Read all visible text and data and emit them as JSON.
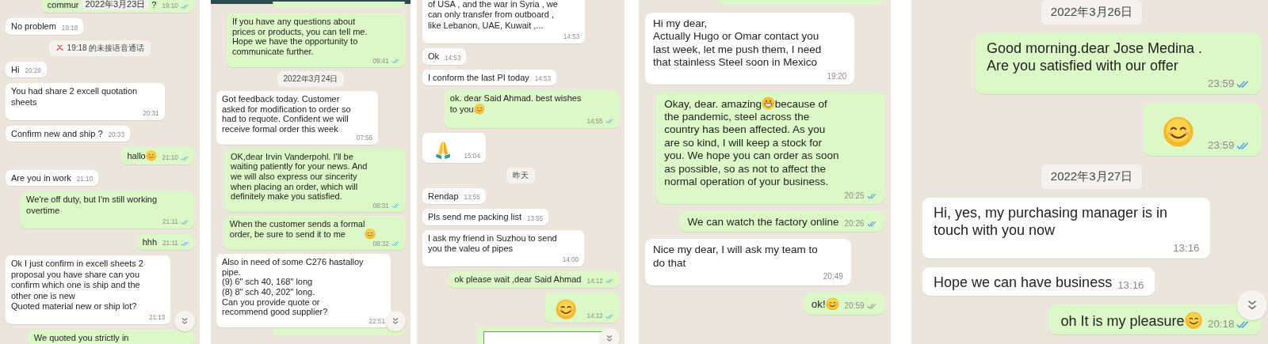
{
  "panels": [
    {
      "app_bar": false,
      "scroll_button": true,
      "messages": [
        {
          "kind": "out",
          "parts": [
            {
              "kind": "text",
              "text": "commur"
            },
            {
              "kind": "date",
              "text": "2022年3月23日"
            },
            {
              "kind": "text",
              "text": "?"
            }
          ],
          "time": "19:10",
          "read": true
        },
        {
          "kind": "in",
          "parts": [
            {
              "kind": "text",
              "text": "No problem"
            }
          ],
          "time": "19:18"
        },
        {
          "kind": "missed_call",
          "text": "19:18 的未接语音通话"
        },
        {
          "kind": "in",
          "parts": [
            {
              "kind": "text",
              "text": "Hi"
            }
          ],
          "time": "20:29"
        },
        {
          "kind": "in",
          "parts": [
            {
              "kind": "text",
              "text": "You had share 2 excell quotation\nsheets"
            }
          ],
          "time": "20:31"
        },
        {
          "kind": "in",
          "parts": [
            {
              "kind": "text",
              "text": "Confirm new and ship ?"
            }
          ],
          "time": "20:33"
        },
        {
          "kind": "out",
          "parts": [
            {
              "kind": "text",
              "text": "hallo"
            },
            {
              "kind": "smile"
            }
          ],
          "time": "21:10",
          "read": true
        },
        {
          "kind": "in",
          "parts": [
            {
              "kind": "text",
              "text": "Are you in work"
            }
          ],
          "time": "21:10"
        },
        {
          "kind": "out",
          "parts": [
            {
              "kind": "text",
              "text": "We're off duty, but I'm still working\novertime"
            }
          ],
          "time": "21:11",
          "read": true
        },
        {
          "kind": "out",
          "parts": [
            {
              "kind": "text",
              "text": "hhh"
            }
          ],
          "time": "21:11",
          "read": true
        },
        {
          "kind": "in",
          "parts": [
            {
              "kind": "text",
              "text": "Ok I just confirm in excell sheets 2\nproposal you have share can you\nconfirm which one is ship and the\nother one is new\nQuoted material new or ship lot?"
            }
          ],
          "time": "21:13"
        },
        {
          "kind": "out",
          "parts": [
            {
              "kind": "text",
              "text": "We quoted you strictly in"
            }
          ]
        }
      ]
    },
    {
      "app_bar": true,
      "scroll_button": true,
      "messages": [
        {
          "kind": "out_fragment"
        },
        {
          "kind": "out",
          "parts": [
            {
              "kind": "text",
              "text": "If you have any questions about\nprices or products, you can tell me.\nHope we have the opportunity to\ncommunicate further."
            }
          ],
          "time": "09:41",
          "read": true
        },
        {
          "kind": "date",
          "text": "2022年3月24日"
        },
        {
          "kind": "in",
          "parts": [
            {
              "kind": "text",
              "text": "Got feedback today.  Customer\nasked for modification to order so\nhad to requote.  Confident we will\nreceive formal order this week"
            }
          ],
          "time": "07:56"
        },
        {
          "kind": "out",
          "parts": [
            {
              "kind": "text",
              "text": "OK,dear Irvin Vanderpohl. I'll be\nwaiting patiently for your news. And\nwe will also express our sincerity\nwhen placing an order, which will\ndefinitely make you satisfied."
            }
          ],
          "time": "08:31",
          "read": true
        },
        {
          "kind": "out",
          "parts": [
            {
              "kind": "text",
              "text": "When the customer sends a formal\norder, be sure to send it to me"
            },
            {
              "kind": "smile"
            }
          ],
          "time": "08:32",
          "read": true
        },
        {
          "kind": "in",
          "parts": [
            {
              "kind": "text",
              "text": "Also in need of some C276 hastalloy\npipe.\n(9) 6\" sch 40, 168\" long\n(8) 8\" sch 40, 202\" long.\nCan you provide quote or\nrecommend good supplier?"
            }
          ],
          "time": "22:51"
        },
        {
          "kind": "out_fragment"
        }
      ]
    },
    {
      "app_bar": false,
      "scroll_button": true,
      "messages": [
        {
          "kind": "in",
          "parts": [
            {
              "kind": "text",
              "text": "of USA  , and the war in Syria , we\ncan only transfer from outboard ,\nlike Lebanon, UAE, Kuwait ,..."
            }
          ],
          "time": "14:53"
        },
        {
          "kind": "in",
          "parts": [
            {
              "kind": "text",
              "text": "Ok"
            }
          ],
          "time": "14:53"
        },
        {
          "kind": "in",
          "parts": [
            {
              "kind": "text",
              "text": "I conform the last PI today"
            }
          ],
          "time": "14:53"
        },
        {
          "kind": "out",
          "parts": [
            {
              "kind": "paragraph",
              "text": "ok. dear Said Ahmad.  best wishes"
            },
            {
              "kind": "text",
              "text": "to you"
            },
            {
              "kind": "smile"
            }
          ],
          "time": "14:55",
          "read": true
        },
        {
          "kind": "in",
          "parts": [
            {
              "kind": "pray"
            }
          ],
          "time": "15:04"
        },
        {
          "kind": "date",
          "text": "昨天"
        },
        {
          "kind": "in",
          "parts": [
            {
              "kind": "text",
              "text": "Rendap"
            }
          ],
          "time": "13:55"
        },
        {
          "kind": "in",
          "parts": [
            {
              "kind": "text",
              "text": "Pls send me packing list"
            }
          ],
          "time": "13:55"
        },
        {
          "kind": "in",
          "parts": [
            {
              "kind": "text",
              "text": "I ask my friend in Suzhou to send\nyou the valeu of pipes"
            }
          ],
          "time": "14:00"
        },
        {
          "kind": "out",
          "parts": [
            {
              "kind": "text",
              "text": "ok please wait ,dear Said Ahmad"
            }
          ],
          "time": "14:12",
          "read": true
        },
        {
          "kind": "out",
          "parts": [
            {
              "kind": "smile"
            }
          ],
          "time": "14:12",
          "read": true
        },
        {
          "kind": "out_document"
        }
      ]
    },
    {
      "app_bar": false,
      "scroll_button": false,
      "messages": [
        {
          "kind": "out_fragment"
        },
        {
          "kind": "in",
          "parts": [
            {
              "kind": "text",
              "text": "Hi my dear,\nActually Hugo or Omar contact you\nlast week, let me push them, I need\nthat stainless Steel soon in Mexico"
            }
          ],
          "time": "19:20"
        },
        {
          "kind": "out",
          "parts": [
            {
              "kind": "text",
              "text": "Okay, dear. amazing"
            },
            {
              "kind": "grin"
            },
            {
              "kind": "text",
              "text": "because of"
            },
            {
              "kind": "paragraph",
              "text": "the pandemic, steel across the\ncountry has been affected. As you\nare so kind, I will keep a stock for\nyou. We hope you can order as soon\nas possible, so as not to affect the\nnormal operation of your business."
            }
          ],
          "time": "20:25",
          "read": true
        },
        {
          "kind": "out",
          "parts": [
            {
              "kind": "text",
              "text": "We can watch the factory online"
            }
          ],
          "time": "20:26",
          "read": true
        },
        {
          "kind": "in",
          "parts": [
            {
              "kind": "text",
              "text": "Nice my dear, I will ask my team to\ndo that"
            }
          ],
          "time": "20:49"
        },
        {
          "kind": "out",
          "parts": [
            {
              "kind": "text",
              "text": "ok!"
            },
            {
              "kind": "smile"
            }
          ],
          "time": "20:59",
          "read": false
        }
      ]
    },
    {
      "app_bar": false,
      "scroll_button": true,
      "messages": [
        {
          "kind": "date",
          "text": "2022年3月26日"
        },
        {
          "kind": "out",
          "parts": [
            {
              "kind": "text",
              "text": "Good morning.dear Jose Medina .\nAre you satisfied with our offer"
            }
          ],
          "time": "23:59",
          "read": true
        },
        {
          "kind": "out",
          "parts": [
            {
              "kind": "smile"
            }
          ],
          "time": "23:59",
          "read": true
        },
        {
          "kind": "date",
          "text": "2022年3月27日"
        },
        {
          "kind": "in",
          "parts": [
            {
              "kind": "text",
              "text": "Hi, yes, my purchasing manager is in\ntouch with you now"
            }
          ],
          "time": "13:16"
        },
        {
          "kind": "in",
          "parts": [
            {
              "kind": "text",
              "text": "Hope we can have business"
            }
          ],
          "time": "13:16"
        },
        {
          "kind": "out",
          "parts": [
            {
              "kind": "text",
              "text": "oh It is my pleasure"
            },
            {
              "kind": "smile"
            }
          ],
          "time": "20:18",
          "read": true
        }
      ]
    }
  ]
}
